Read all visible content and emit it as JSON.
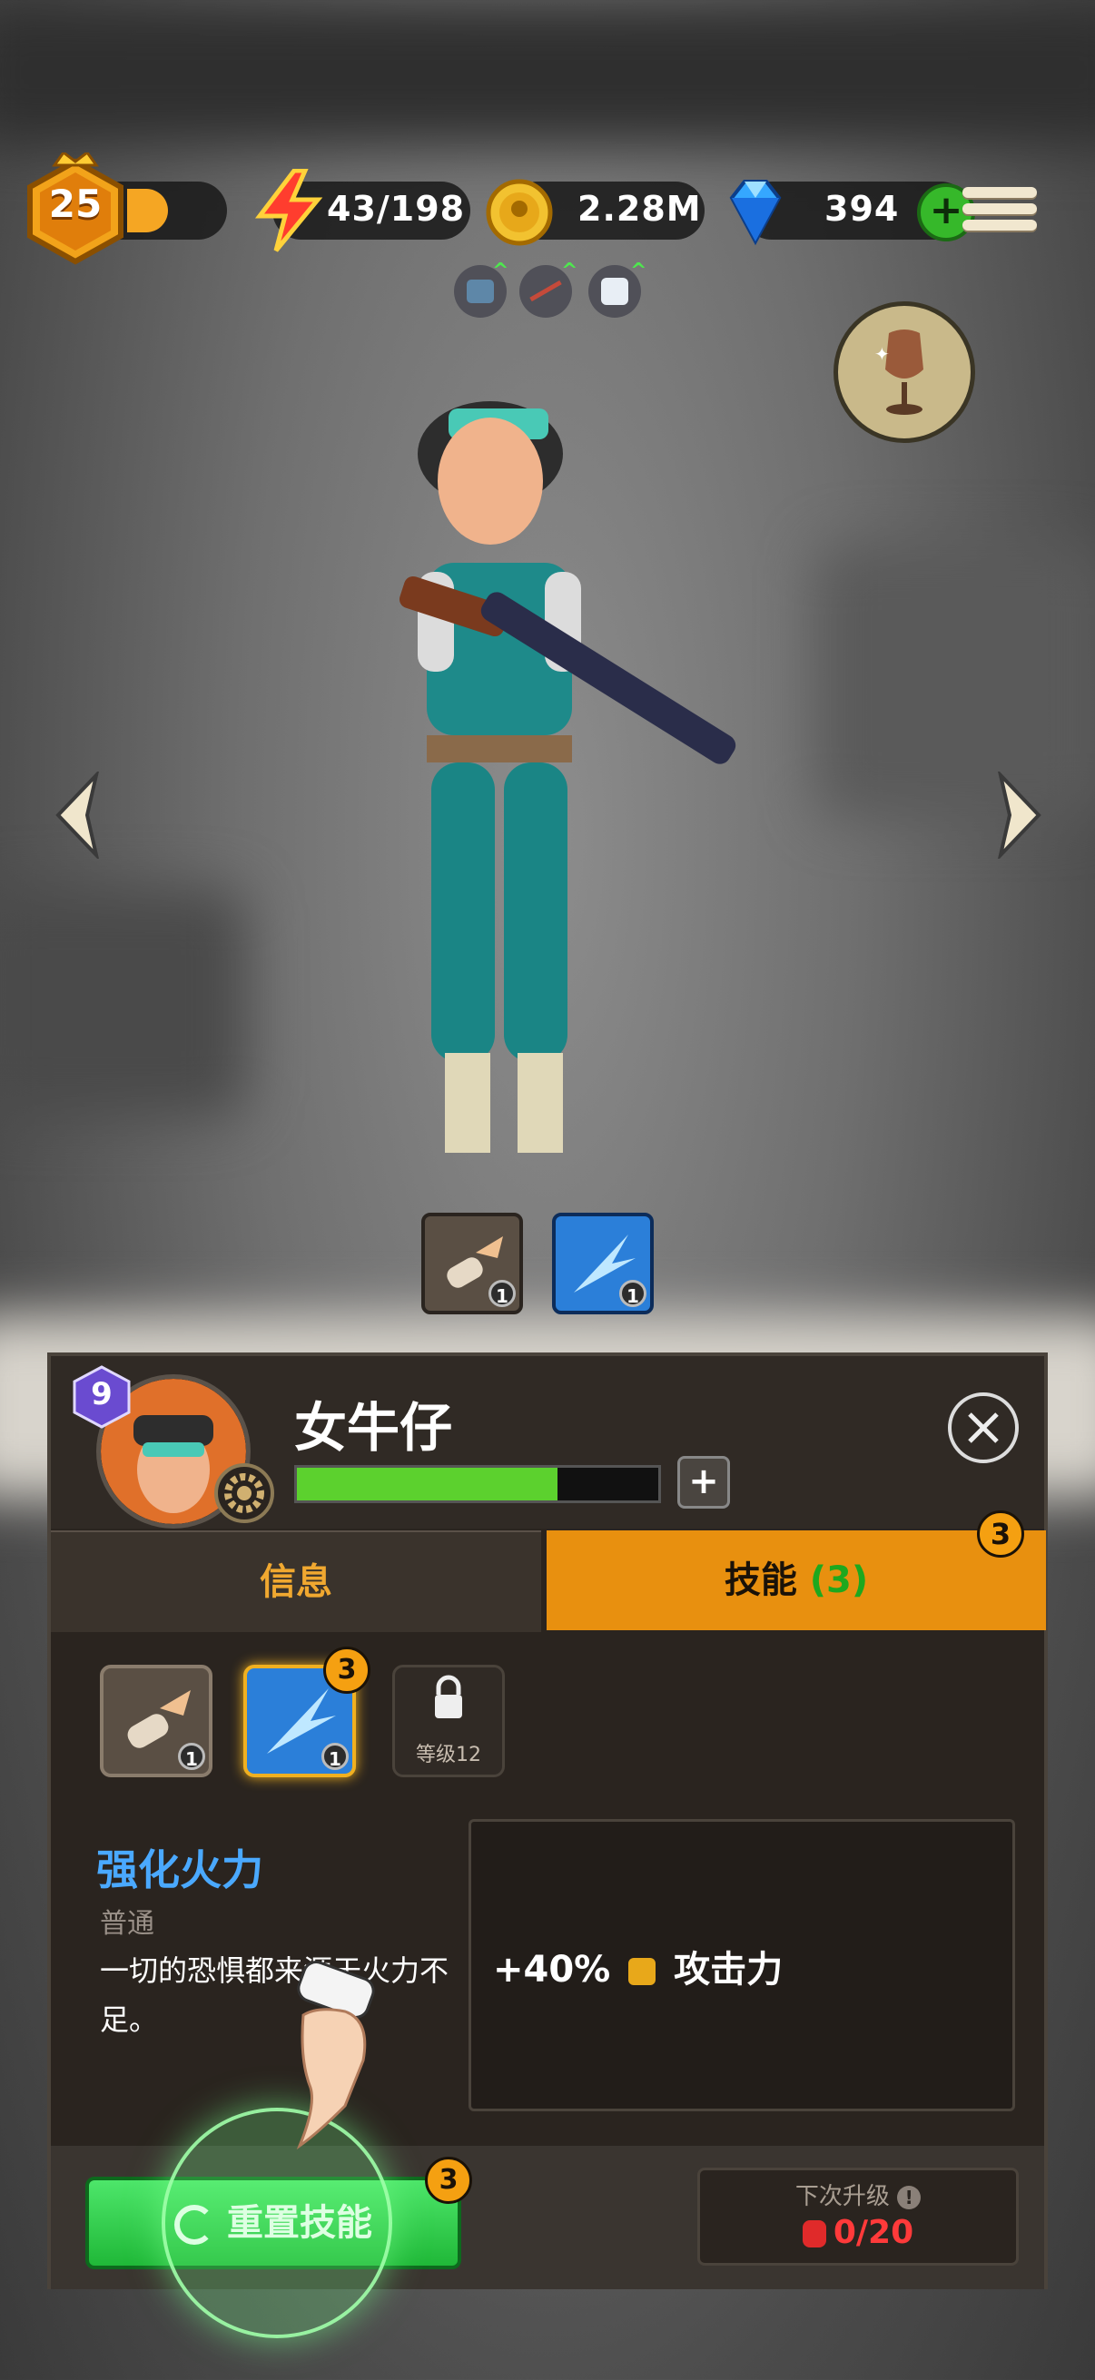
{
  "hud": {
    "player_level": "25",
    "energy": "43/198",
    "coins": "2.28M",
    "gems": "394",
    "icons": [
      "crown-badge-icon",
      "lightning-icon",
      "gold-coin-icon",
      "diamond-icon",
      "plus-icon",
      "menu-icon"
    ]
  },
  "boosts": [
    "backpack-icon",
    "arrows-icon",
    "dice-icon"
  ],
  "equipped_skills": [
    {
      "icon": "bullet-icon",
      "level": "1"
    },
    {
      "icon": "blue-shot-icon",
      "level": "1"
    }
  ],
  "panel": {
    "hero_level": "9",
    "hero_name": "女牛仔",
    "hp_fraction": 0.72,
    "plus": "+",
    "tabs": {
      "info": "信息",
      "skill_prefix": "技能 ",
      "skill_count": "(3)"
    },
    "tab_badge": "3",
    "skills": [
      {
        "level": "1",
        "badge": ""
      },
      {
        "level": "1",
        "badge": "3"
      },
      {
        "locked_label": "等级12"
      }
    ],
    "skill_name": "强化火力",
    "skill_type": "普通",
    "skill_desc": "一切的恐惧都来源于火力不足。",
    "effect_value": "+40%",
    "effect_stat": "攻击力",
    "reset_label": "重置技能",
    "reset_badge": "3",
    "next_label": "下次升级",
    "next_value": "0/20"
  },
  "colors": {
    "accent": "#e8900f",
    "green": "#4de66a",
    "skill_blue": "#4aa9ff",
    "red": "#ff3a3a"
  }
}
